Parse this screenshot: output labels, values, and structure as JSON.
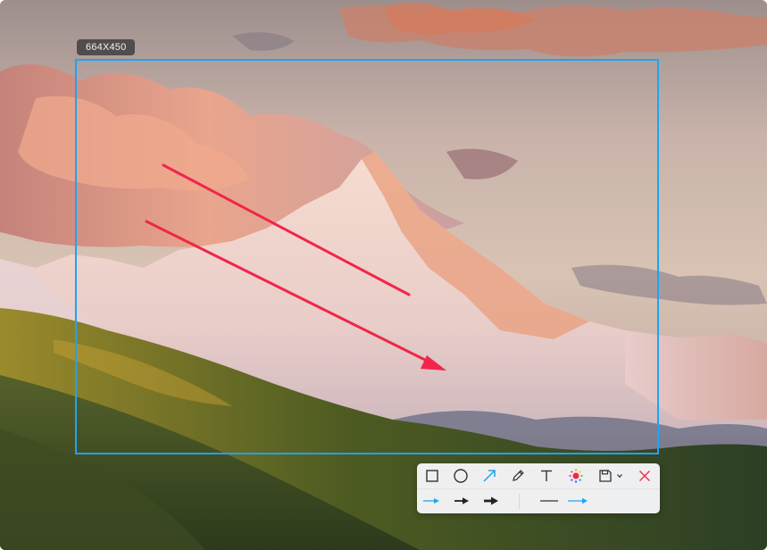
{
  "capture": {
    "size_label": "664X450"
  },
  "toolbar": {
    "tools": [
      {
        "name": "rectangle-tool",
        "icon": "rectangle-icon"
      },
      {
        "name": "ellipse-tool",
        "icon": "ellipse-icon"
      },
      {
        "name": "arrow-tool",
        "icon": "arrow-icon",
        "active": true
      },
      {
        "name": "pen-tool",
        "icon": "pencil-icon"
      },
      {
        "name": "text-tool",
        "icon": "text-icon"
      },
      {
        "name": "mosaic-tool",
        "icon": "mosaic-icon"
      },
      {
        "name": "save-tool",
        "icon": "save-icon"
      },
      {
        "name": "save-options",
        "icon": "chevron-down-icon"
      },
      {
        "name": "close-tool",
        "icon": "close-icon"
      }
    ],
    "arrow_style_options": [
      {
        "name": "arrow-style-thin",
        "icon": "thin-arrow-icon",
        "selected": true
      },
      {
        "name": "arrow-style-medium",
        "icon": "medium-arrow-icon"
      },
      {
        "name": "arrow-style-bold",
        "icon": "bold-arrow-icon"
      }
    ],
    "line_style_options": [
      {
        "name": "line-style-plain",
        "icon": "line-icon"
      },
      {
        "name": "line-style-arrow",
        "icon": "line-arrow-icon",
        "selected": true
      }
    ]
  },
  "colors": {
    "selection_border": "#1ea4f2",
    "annotation_arrow": "#f0264a",
    "active_tool": "#1ea4f2",
    "close": "#e8364f"
  }
}
